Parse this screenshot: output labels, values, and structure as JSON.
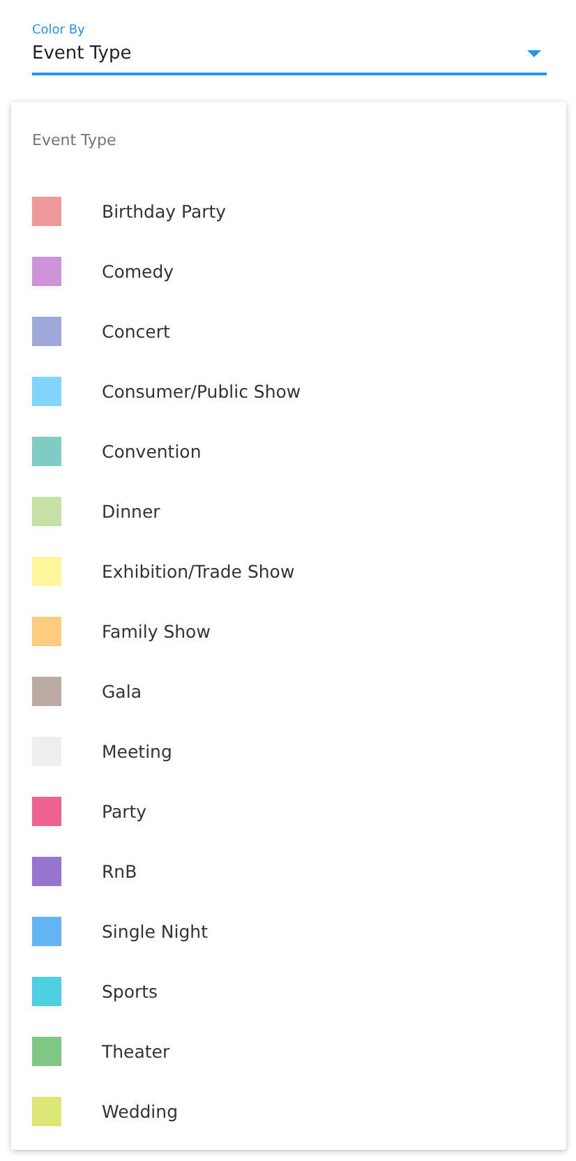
{
  "color_by": {
    "label": "Color By",
    "value": "Event Type"
  },
  "legend": {
    "title": "Event Type",
    "items": [
      {
        "label": "Birthday Party",
        "color": "#ef9a9a"
      },
      {
        "label": "Comedy",
        "color": "#ce93d8"
      },
      {
        "label": "Concert",
        "color": "#9fa8da"
      },
      {
        "label": "Consumer/Public Show",
        "color": "#81d4fa"
      },
      {
        "label": "Convention",
        "color": "#80cbc4"
      },
      {
        "label": "Dinner",
        "color": "#c5e1a5"
      },
      {
        "label": "Exhibition/Trade Show",
        "color": "#fff59d"
      },
      {
        "label": "Family Show",
        "color": "#ffcc80"
      },
      {
        "label": "Gala",
        "color": "#bcaaa4"
      },
      {
        "label": "Meeting",
        "color": "#eeeeee"
      },
      {
        "label": "Party",
        "color": "#f06292"
      },
      {
        "label": "RnB",
        "color": "#9575cd"
      },
      {
        "label": "Single Night",
        "color": "#64b5f6"
      },
      {
        "label": "Sports",
        "color": "#4dd0e1"
      },
      {
        "label": "Theater",
        "color": "#81c784"
      },
      {
        "label": "Wedding",
        "color": "#dce775"
      }
    ]
  }
}
